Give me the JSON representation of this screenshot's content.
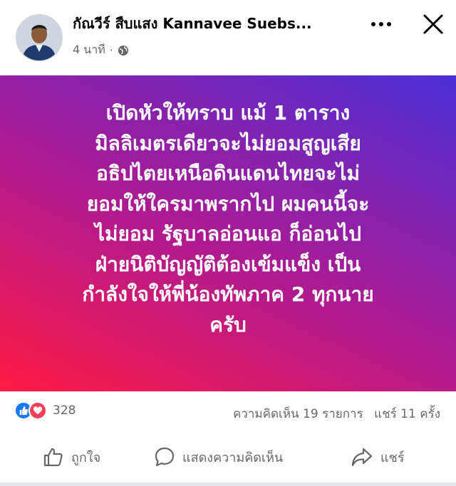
{
  "post": {
    "author": "กัณวีร์ สืบแสง Kannavee Suebs...",
    "time": "4 นาที",
    "privacy_icon": "globe-icon",
    "text": "เปิดหัวให้ทราบ แม้ 1 ตาราง\nมิลลิเมตรเดียวจะไม่ยอมสูญเสีย\nอธิปไตยเหนือดินแดนไทยจะไม่\nยอมให้ใครมาพรากไป ผมคนนี้จะ\nไม่ยอม รัฐบาลอ่อนแอ ก็อ่อนไป\nฝ่ายนิติบัญญัติต้องเข้มแข็ง เป็น\nกำลังใจให้พี่น้องทัพภาค 2 ทุกนาย\nครับ",
    "background_gradient": [
      "#ff1a44",
      "#b01a90",
      "#4a2fd6"
    ]
  },
  "stats": {
    "reaction_icons": [
      "like-icon",
      "love-icon"
    ],
    "reaction_count": "328",
    "comments": "ความคิดเห็น 19 รายการ",
    "shares": "แชร์ 11 ครั้ง"
  },
  "actions": {
    "like_label": "ถูกใจ",
    "comment_label": "แสดงความคิดเห็น",
    "share_label": "แชร์"
  },
  "colors": {
    "like_blue": "#1877f2",
    "love_red": "#f33e58",
    "secondary_text": "#65676b"
  }
}
